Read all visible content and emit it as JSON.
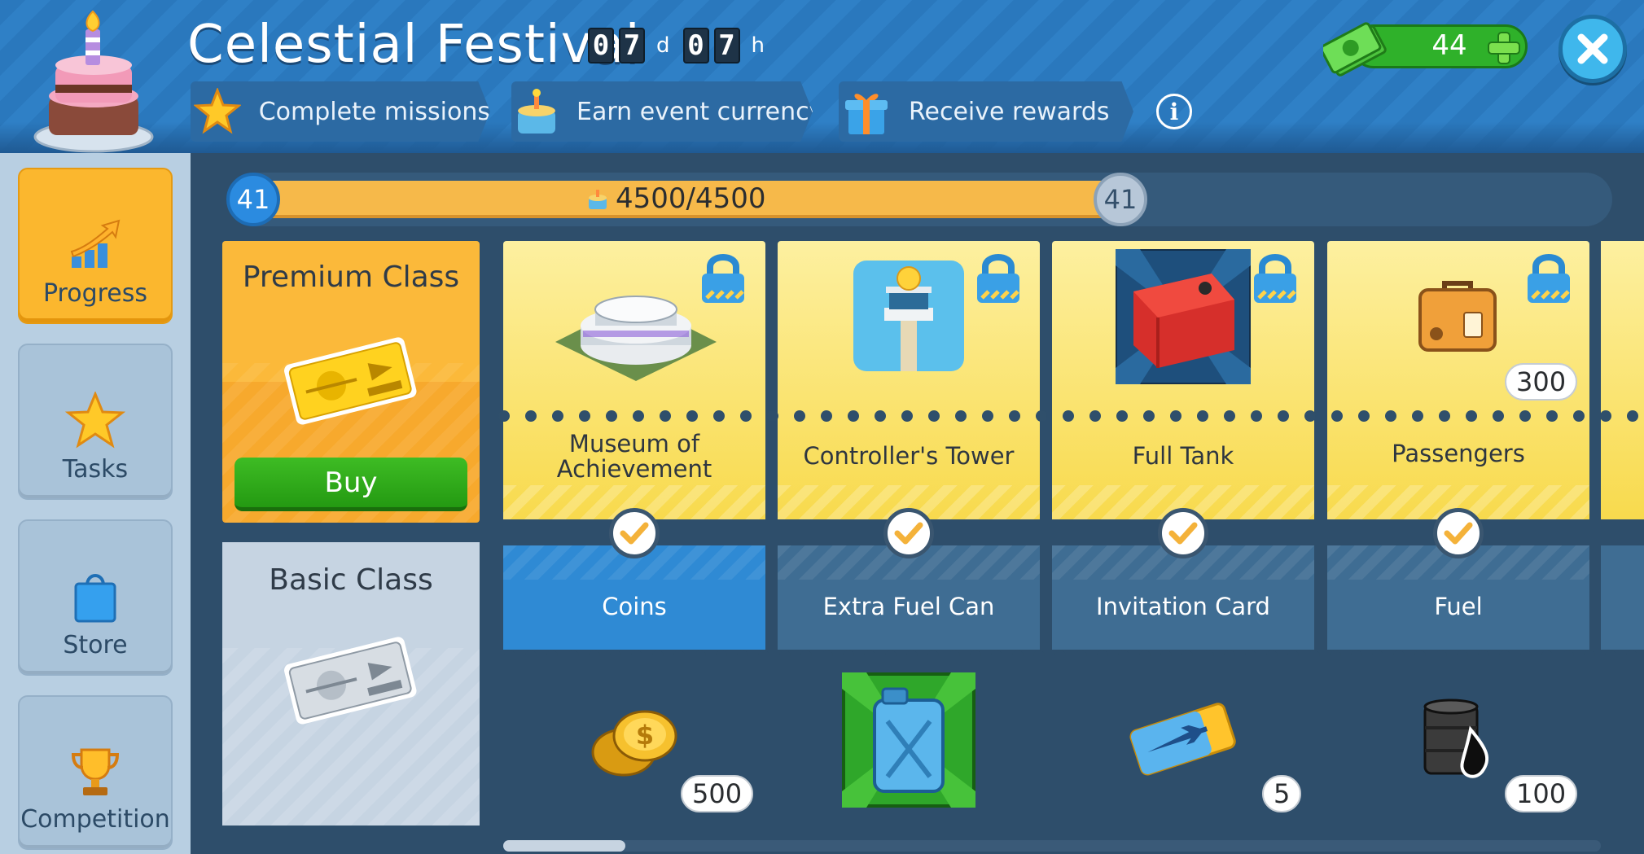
{
  "header": {
    "title": "Celestial Festival",
    "timer": {
      "days_d1": "0",
      "days_d2": "7",
      "days_unit": "d",
      "hours_d1": "0",
      "hours_d2": "7",
      "hours_unit": "h"
    },
    "steps": [
      {
        "label": "Complete missions",
        "icon": "star-icon"
      },
      {
        "label": "Earn event currency",
        "icon": "cake-currency-icon"
      },
      {
        "label": "Receive rewards",
        "icon": "gift-icon"
      }
    ],
    "currency_value": "44",
    "colors": {
      "header_blue": "#2f80c6",
      "money_green": "#2fb12a",
      "close_blue": "#3fb7ec"
    }
  },
  "sidebar": {
    "items": [
      {
        "label": "Progress",
        "icon": "progress-chart-icon",
        "active": true
      },
      {
        "label": "Tasks",
        "icon": "star-icon",
        "active": false
      },
      {
        "label": "Store",
        "icon": "shopping-bag-icon",
        "active": false
      },
      {
        "label": "Competition",
        "icon": "trophy-icon",
        "active": false
      }
    ]
  },
  "progress": {
    "level_start": "41",
    "level_end": "41",
    "text": "4500/4500",
    "fill_fraction": 1.0
  },
  "premium": {
    "title": "Premium Class",
    "buy_label": "Buy",
    "rewards": [
      {
        "name_line1": "Museum of",
        "name_line2": "Achievement",
        "icon": "museum-building-icon",
        "locked": true
      },
      {
        "name_line1": "Controller's Tower",
        "name_line2": "",
        "icon": "control-tower-icon",
        "locked": true
      },
      {
        "name_line1": "Full Tank",
        "name_line2": "",
        "icon": "red-fuel-tank-icon",
        "locked": true
      },
      {
        "name_line1": "Passengers",
        "name_line2": "",
        "icon": "suitcase-icon",
        "locked": true,
        "amount": "300"
      }
    ]
  },
  "basic": {
    "title": "Basic Class",
    "rewards": [
      {
        "name": "Coins",
        "icon": "gold-coins-icon",
        "amount": "500",
        "claimed": true
      },
      {
        "name": "Extra Fuel Can",
        "icon": "fuel-can-icon",
        "amount": "",
        "claimed": true
      },
      {
        "name": "Invitation Card",
        "icon": "plane-ticket-icon",
        "amount": "5",
        "claimed": true
      },
      {
        "name": "Fuel",
        "icon": "oil-barrel-icon",
        "amount": "100",
        "claimed": true
      }
    ]
  }
}
